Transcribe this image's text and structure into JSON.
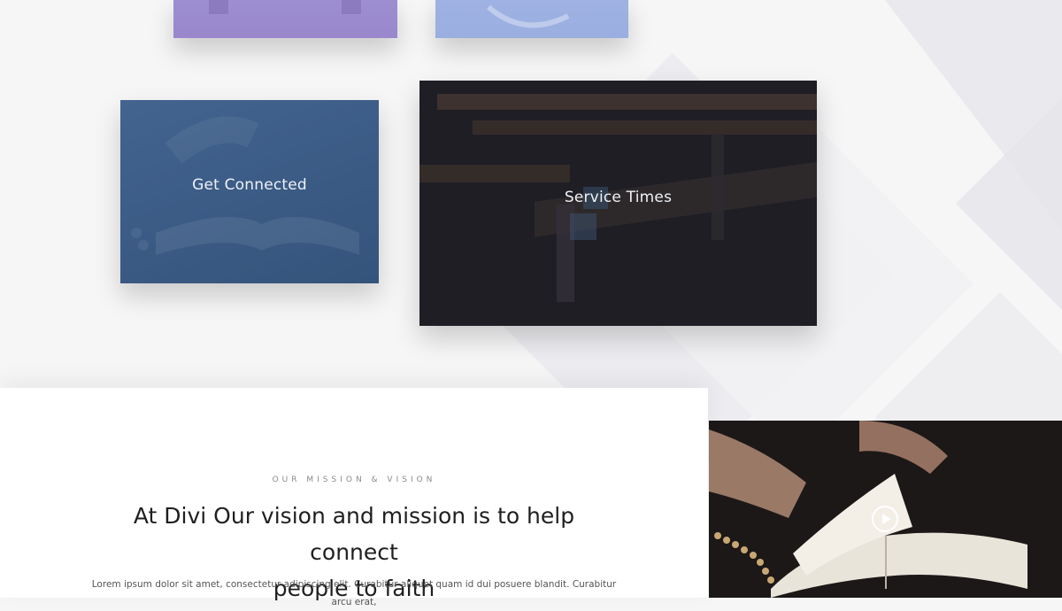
{
  "cards": {
    "get_connected": {
      "label": "Get Connected"
    },
    "service_times": {
      "label": "Service Times"
    }
  },
  "mission": {
    "eyebrow": "OUR MISSION & VISION",
    "headline_line1": "At Divi Our vision and mission is to help connect",
    "headline_line2": "people to faith",
    "body": "Lorem ipsum dolor sit amet, consectetur adipiscing elit. Curabitur aliquet quam id dui posuere blandit. Curabitur arcu erat,"
  },
  "video": {
    "play_icon": "play-circle-icon"
  },
  "colors": {
    "card_purple": "#9a87cc",
    "card_lavender": "#9aaee0",
    "card_blue": "#3a5a84",
    "card_dark": "#25242c",
    "text_dark": "#1f1f1f",
    "text_muted": "#8a8a8a"
  }
}
